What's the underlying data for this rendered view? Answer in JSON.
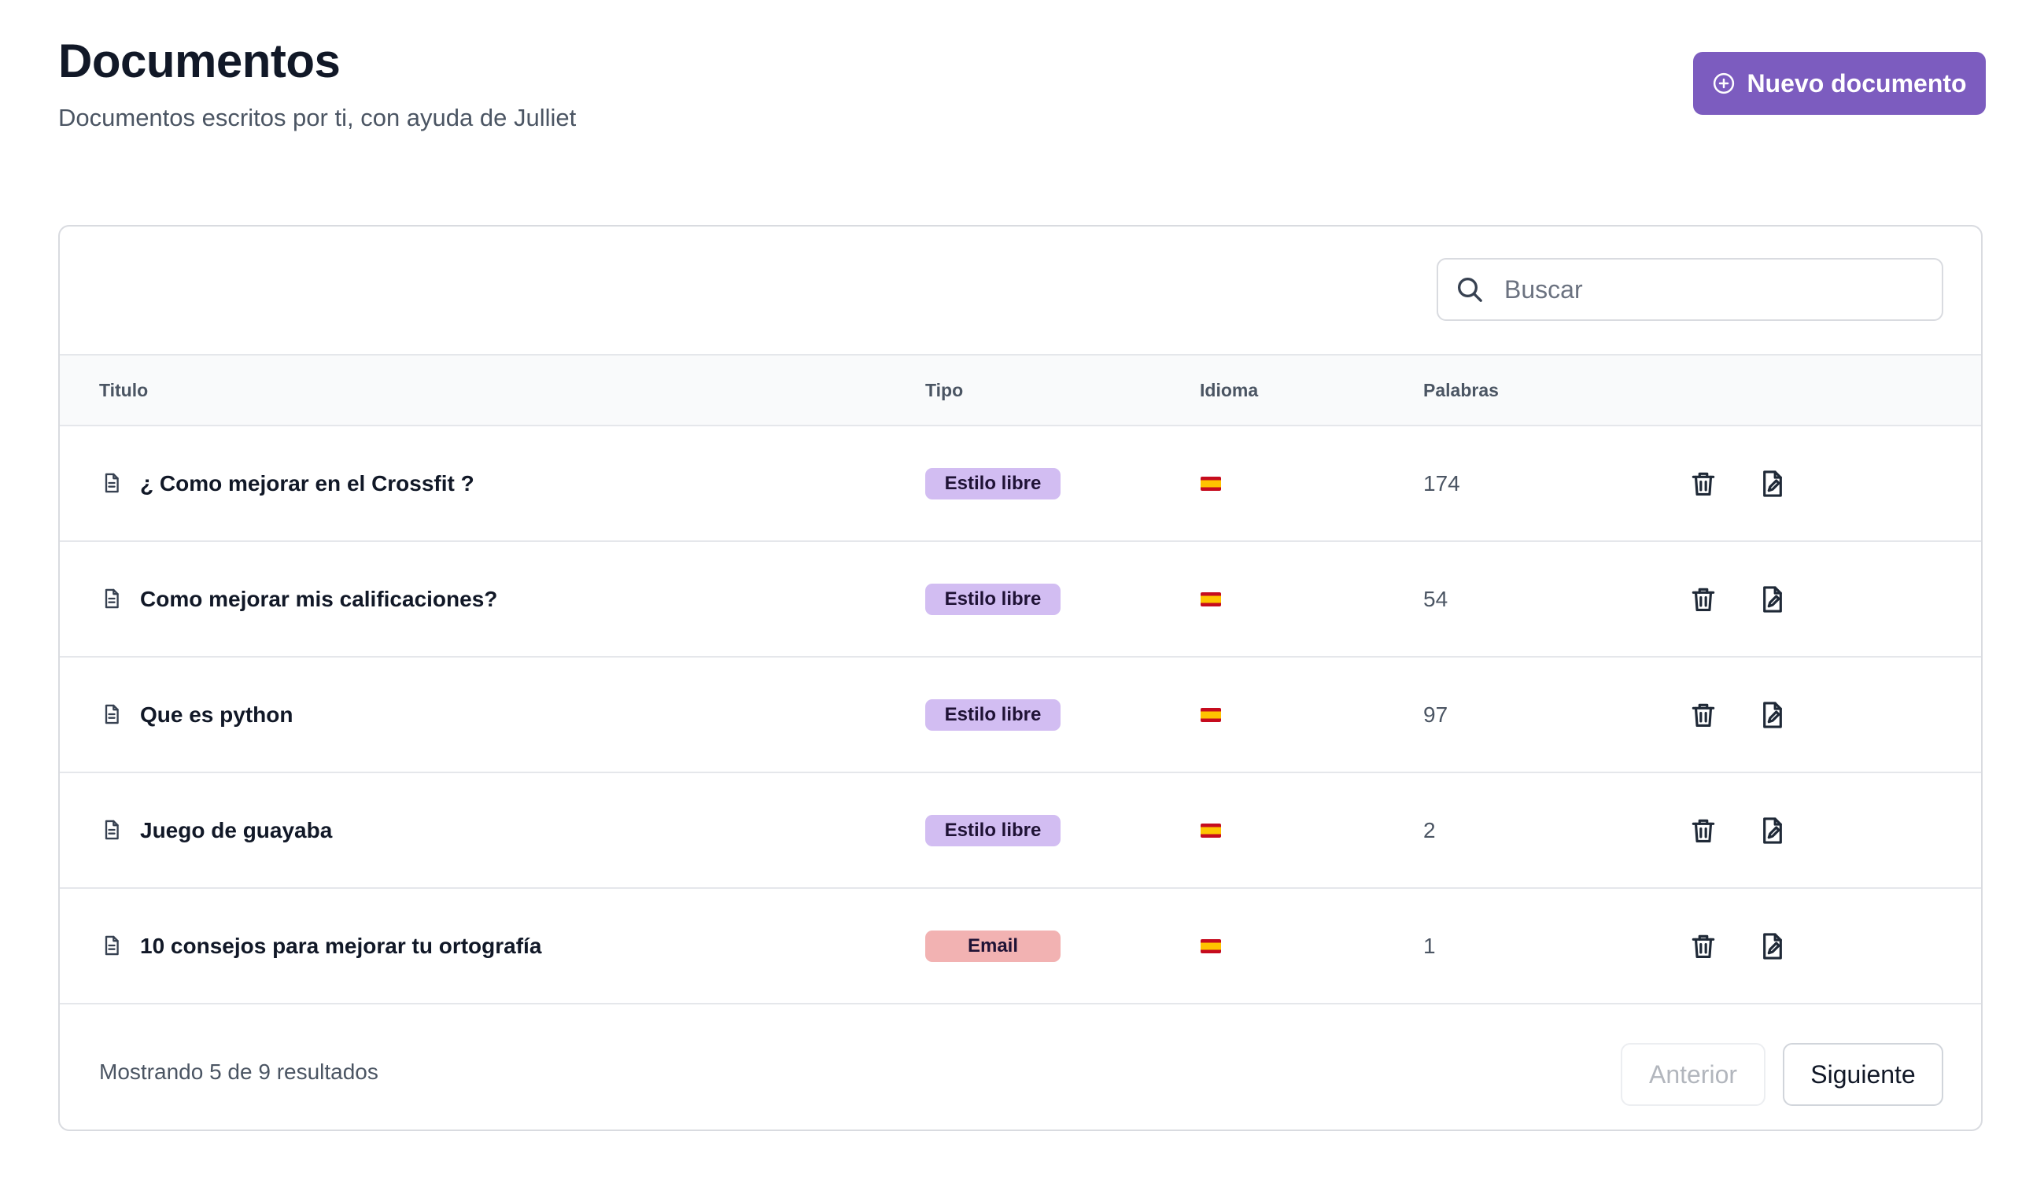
{
  "header": {
    "title": "Documentos",
    "subtitle": "Documentos escritos por ti, con ayuda de Julliet",
    "new_button_label": "Nuevo documento",
    "new_button_icon": "plus-circle-icon"
  },
  "search": {
    "placeholder": "Buscar",
    "value": "",
    "icon": "search-icon"
  },
  "table": {
    "columns": [
      "Titulo",
      "Tipo",
      "Idioma",
      "Palabras"
    ],
    "rows": [
      {
        "title": "¿ Como mejorar en el Crossfit ?",
        "type": "Estilo libre",
        "language": "spanish-flag",
        "words": "174"
      },
      {
        "title": "Como mejorar mis calificaciones?",
        "type": "Estilo libre",
        "language": "spanish-flag",
        "words": "54"
      },
      {
        "title": "Que es python",
        "type": "Estilo libre",
        "language": "spanish-flag",
        "words": "97"
      },
      {
        "title": "Juego de guayaba",
        "type": "Estilo libre",
        "language": "spanish-flag",
        "words": "2"
      },
      {
        "title": "10 consejos para mejorar tu ortografía",
        "type": "Email",
        "language": "spanish-flag",
        "words": "1"
      }
    ]
  },
  "footer": {
    "results_text": "Mostrando 5 de 9 resultados",
    "prev_label": "Anterior",
    "next_label": "Siguiente"
  },
  "colors": {
    "accent": "#7c5cbf",
    "badge_estilo_libre": "#d2bdf2",
    "badge_email": "#f2b2b2",
    "flag_red": "#c60b1e",
    "flag_yellow": "#ffc400"
  }
}
